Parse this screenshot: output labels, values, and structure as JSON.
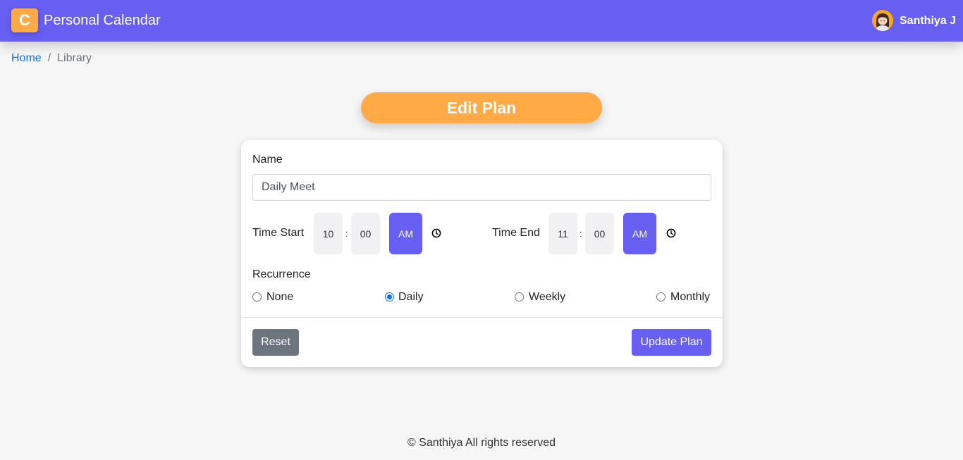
{
  "header": {
    "logo_letter": "C",
    "app_title": "Personal Calendar",
    "user_name": "Santhiya J",
    "colors": {
      "primary": "#675ef2",
      "accent": "#ffaa47"
    }
  },
  "breadcrumb": {
    "home": "Home",
    "separator": "/",
    "current": "Library"
  },
  "page_title": "Edit Plan",
  "form": {
    "name_label": "Name",
    "name_value": "Daily Meet",
    "time_start": {
      "label": "Time Start",
      "hour": "10",
      "minute": "00",
      "period": "AM",
      "icon": "clock-icon"
    },
    "time_end": {
      "label": "Time End",
      "hour": "11",
      "minute": "00",
      "period": "AM",
      "icon": "clock-icon"
    },
    "time_separator": ":",
    "recurrence": {
      "label": "Recurrence",
      "options": [
        "None",
        "Daily",
        "Weekly",
        "Monthly"
      ],
      "selected": "Daily"
    },
    "reset_label": "Reset",
    "submit_label": "Update Plan"
  },
  "footer": "© Santhiya All rights reserved"
}
